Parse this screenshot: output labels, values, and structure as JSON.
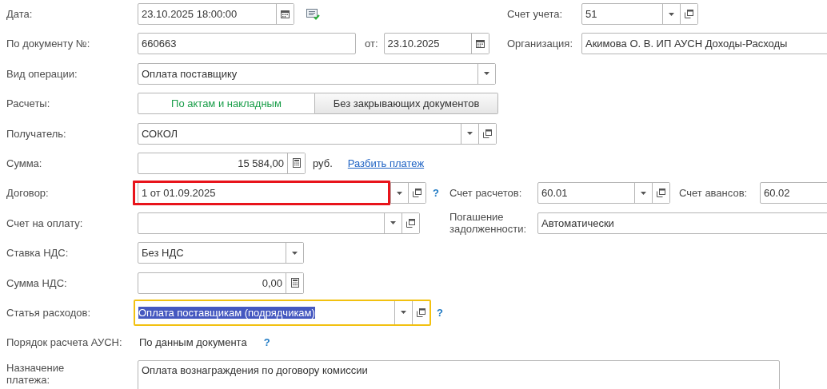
{
  "date": {
    "label": "Дата:",
    "value": "23.10.2025 18:00:00"
  },
  "account": {
    "label": "Счет учета:",
    "value": "51"
  },
  "doc_number": {
    "label": "По документу №:",
    "value": "660663",
    "date_label": "от:",
    "date_value": "23.10.2025"
  },
  "organization": {
    "label": "Организация:",
    "value": "Акимова О. В. ИП АУСН Доходы-Расходы"
  },
  "operation": {
    "label": "Вид операции:",
    "value": "Оплата поставщику"
  },
  "settlements": {
    "label": "Расчеты:",
    "options": [
      {
        "label": "По актам и накладным",
        "selected": true
      },
      {
        "label": "Без закрывающих документов",
        "selected": false
      }
    ]
  },
  "recipient": {
    "label": "Получатель:",
    "value": "СОКОЛ"
  },
  "amount": {
    "label": "Сумма:",
    "value": "15 584,00",
    "currency": "руб.",
    "link": "Разбить платеж"
  },
  "contract": {
    "label": "Договор:",
    "value": "1 от 01.09.2025",
    "highlighted": true,
    "help": "?"
  },
  "settlement_account": {
    "label": "Счет расчетов:",
    "value": "60.01"
  },
  "advance_account": {
    "label": "Счет авансов:",
    "value": "60.02"
  },
  "invoice": {
    "label": "Счет на оплату:"
  },
  "debt_repayment": {
    "label": "Погашение задолженности:",
    "value": "Автоматически"
  },
  "vat_rate": {
    "label": "Ставка НДС:",
    "value": "Без НДС"
  },
  "vat_amount": {
    "label": "Сумма НДС:",
    "value": "0,00"
  },
  "expense_item": {
    "label": "Статья расходов:",
    "value": "Оплата поставщикам (подрядчикам)",
    "focused": true,
    "help": "?"
  },
  "usn_order": {
    "label": "Порядок расчета АУСН:",
    "value": "По данным документа",
    "help": "?"
  },
  "purpose": {
    "label": "Назначение платежа:",
    "value": "Оплата вознаграждения по договору комиссии"
  }
}
